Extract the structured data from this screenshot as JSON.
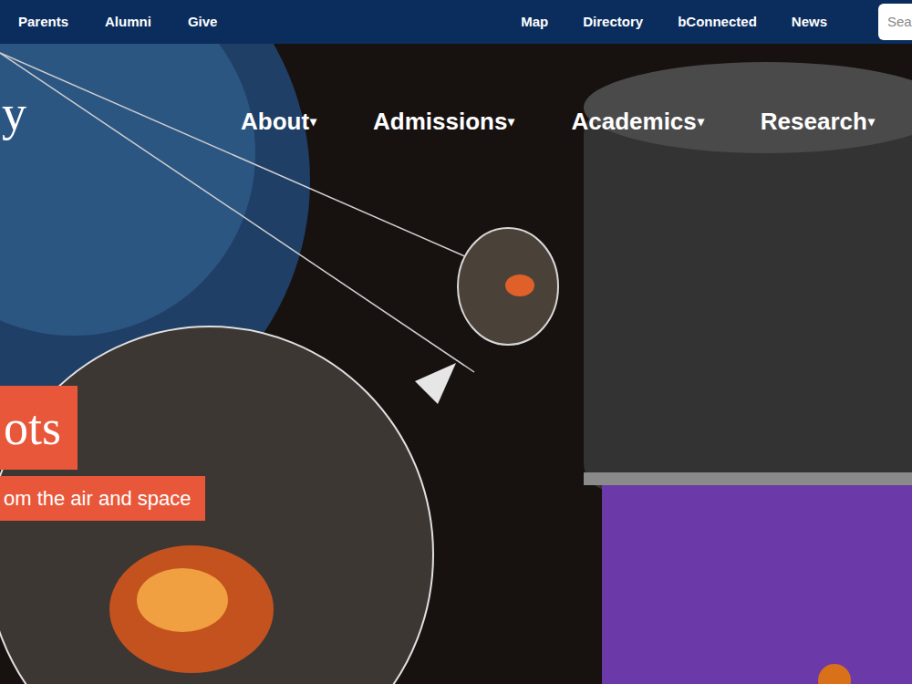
{
  "top_bar": {
    "links_left": [
      "Parents",
      "Alumni",
      "Give"
    ],
    "links_right": [
      "Map",
      "Directory",
      "bConnected",
      "News"
    ],
    "search": {
      "placeholder": "Sea"
    }
  },
  "logo": {
    "text": "y"
  },
  "main_nav": {
    "items": [
      {
        "label": "About",
        "caret": "▾"
      },
      {
        "label": "Admissions",
        "caret": "▾"
      },
      {
        "label": "Academics",
        "caret": "▾"
      },
      {
        "label": "Research",
        "caret": "▾"
      }
    ]
  },
  "hero": {
    "headline": "ots",
    "subheadline": "om the air and space"
  }
}
